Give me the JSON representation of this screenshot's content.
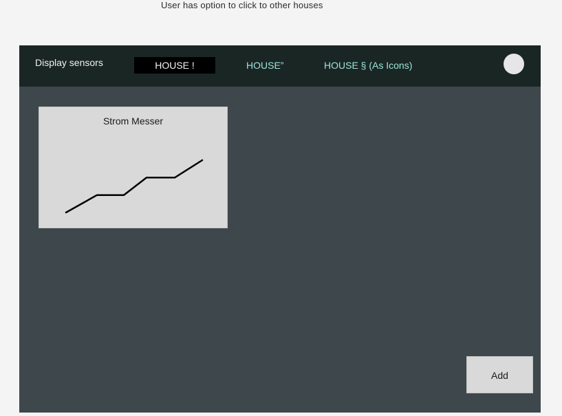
{
  "annotation": "User has option to click to other houses",
  "topbar": {
    "brand": "Display sensors",
    "tabs": [
      {
        "label": "HOUSE !",
        "active": true
      },
      {
        "label": "HOUSE”",
        "active": false
      },
      {
        "label": "HOUSE § (As Icons)",
        "active": false
      }
    ],
    "avatar_icon": "user-avatar-circle"
  },
  "sensor_card": {
    "title": "Strom Messer",
    "trend_values": [
      1,
      2,
      2,
      3,
      3,
      4
    ],
    "line_color": "#000000"
  },
  "actions": {
    "add_label": "Add"
  },
  "colors": {
    "page_bg": "#f4f4f4",
    "frame_bg": "#3e474c",
    "topbar_bg": "#1a2624",
    "tab_text": "#9ee4dc",
    "active_tab_bg": "#000000",
    "card_bg": "#d9d9d9"
  }
}
